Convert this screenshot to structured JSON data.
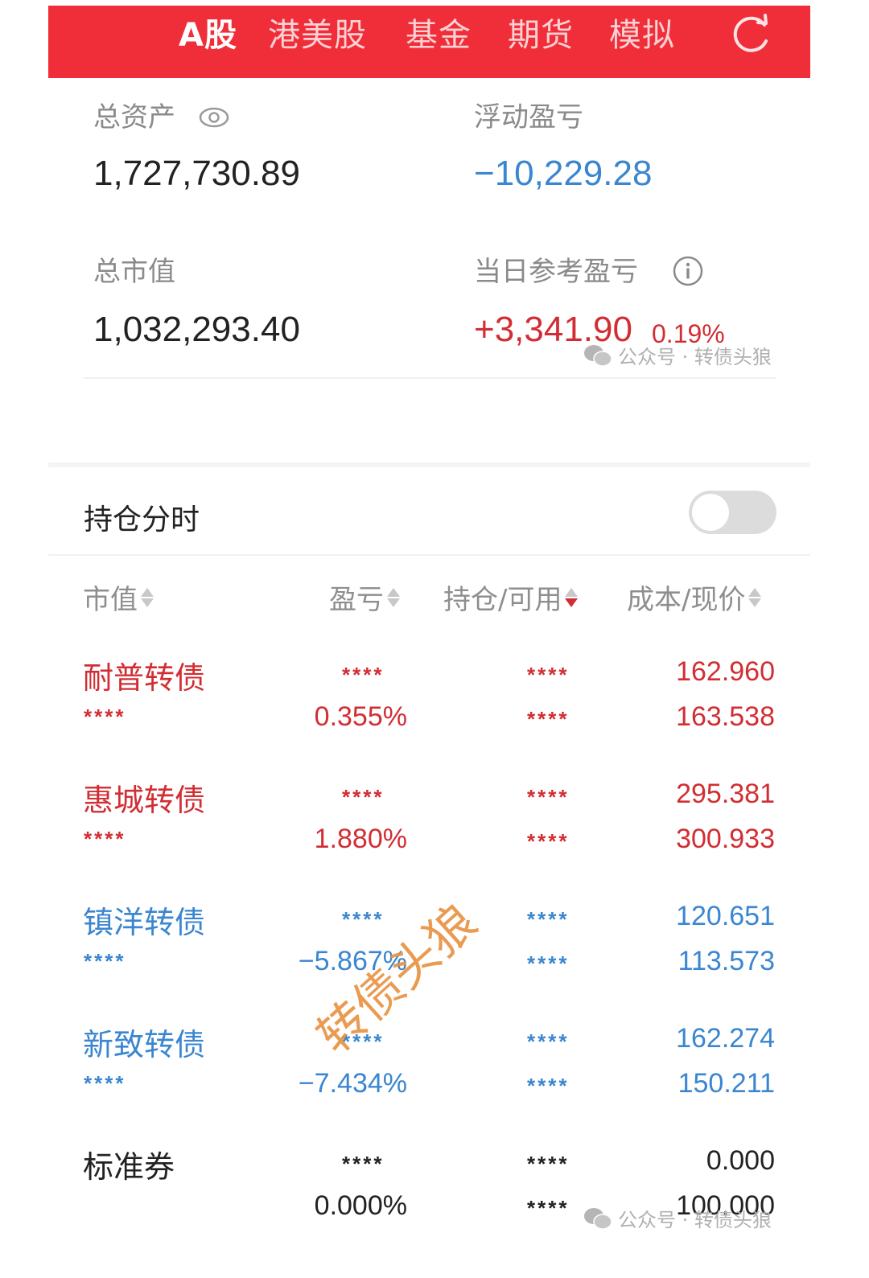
{
  "topbar": {
    "tabs": [
      {
        "label": "A股",
        "active": true
      },
      {
        "label": "港美股",
        "active": false
      },
      {
        "label": "基金",
        "active": false
      },
      {
        "label": "期货",
        "active": false
      },
      {
        "label": "模拟",
        "active": false
      }
    ],
    "refresh_icon": "refresh-icon",
    "bg_color": "#f02e3a"
  },
  "summary": {
    "total_assets_label": "总资产",
    "total_assets_value": "1,727,730.89",
    "floating_pl_label": "浮动盈亏",
    "floating_pl_value": "−10,229.28",
    "market_value_label": "总市值",
    "market_value_value": "1,032,293.40",
    "daily_pl_label": "当日参考盈亏",
    "daily_pl_value": "+3,341.90",
    "daily_pl_pct": "0.19%"
  },
  "watermark": {
    "text": "公众号 · 转债头狼",
    "stamp": "转债头狼"
  },
  "positions": {
    "section_title": "持仓分时",
    "toggle_on": false,
    "columns": [
      {
        "label": "市值",
        "sort": "none"
      },
      {
        "label": "盈亏",
        "sort": "none"
      },
      {
        "label": "持仓/可用",
        "sort": "desc"
      },
      {
        "label": "成本/现价",
        "sort": "none"
      }
    ],
    "rows": [
      {
        "name": "耐普转债",
        "market_value": "****",
        "pl": "****",
        "pl_pct": "0.355%",
        "holding": "****",
        "available": "****",
        "cost": "162.960",
        "price": "163.538",
        "trend": "up"
      },
      {
        "name": "惠城转债",
        "market_value": "****",
        "pl": "****",
        "pl_pct": "1.880%",
        "holding": "****",
        "available": "****",
        "cost": "295.381",
        "price": "300.933",
        "trend": "up"
      },
      {
        "name": "镇洋转债",
        "market_value": "****",
        "pl": "****",
        "pl_pct": "−5.867%",
        "holding": "****",
        "available": "****",
        "cost": "120.651",
        "price": "113.573",
        "trend": "down"
      },
      {
        "name": "新致转债",
        "market_value": "****",
        "pl": "****",
        "pl_pct": "−7.434%",
        "holding": "****",
        "available": "****",
        "cost": "162.274",
        "price": "150.211",
        "trend": "down"
      },
      {
        "name": "标准券",
        "market_value": "",
        "pl": "****",
        "pl_pct": "0.000%",
        "holding": "****",
        "available": "****",
        "cost": "0.000",
        "price": "100.000",
        "trend": "flat"
      }
    ]
  },
  "colors": {
    "up": "#d22d33",
    "down": "#3a86d0",
    "flat": "#222222"
  }
}
